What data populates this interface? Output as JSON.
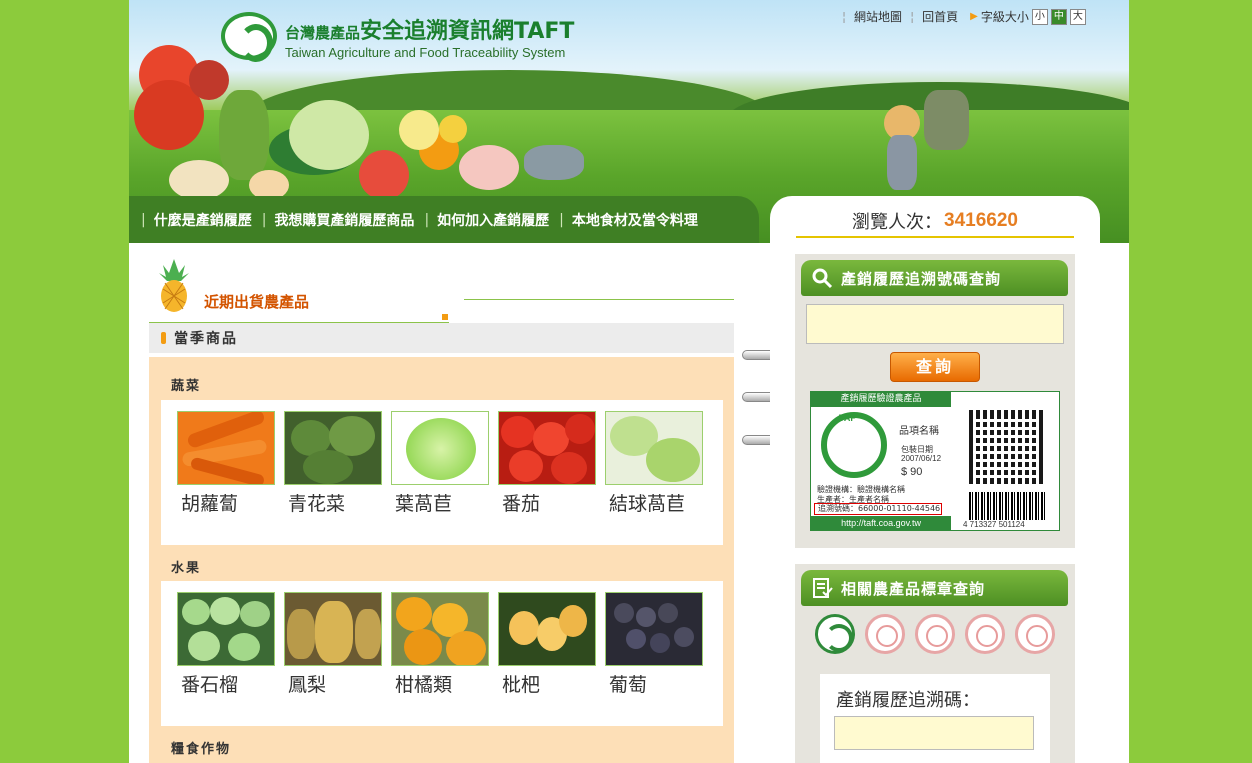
{
  "header": {
    "logo_small": "台灣農產品",
    "logo_title": "安全追溯資訊網TAFT",
    "logo_subtitle": "Taiwan Agriculture and Food Traceability System",
    "top_links": {
      "sitemap": "網站地圖",
      "home": "回首頁",
      "font_size_label": "字級大小",
      "font_small": "小",
      "font_medium": "中",
      "font_large": "大"
    }
  },
  "nav": {
    "items": [
      {
        "label": "什麼是產銷履歷"
      },
      {
        "label": "我想購買產銷履歷商品"
      },
      {
        "label": "如何加入產銷履歷"
      },
      {
        "label": "本地食材及當令料理"
      }
    ]
  },
  "main": {
    "section_title": "近期出貨農產品",
    "season_title": "當季商品",
    "categories": [
      {
        "label": "蔬菜",
        "items": [
          {
            "name": "胡蘿蔔"
          },
          {
            "name": "青花菜"
          },
          {
            "name": "葉萵苣"
          },
          {
            "name": "番茄"
          },
          {
            "name": "結球萵苣"
          }
        ]
      },
      {
        "label": "水果",
        "items": [
          {
            "name": "番石榴"
          },
          {
            "name": "鳳梨"
          },
          {
            "name": "柑橘類"
          },
          {
            "name": "枇杷"
          },
          {
            "name": "葡萄"
          }
        ]
      },
      {
        "label": "糧食作物",
        "items": []
      }
    ]
  },
  "sidebar": {
    "visits_label": "瀏覽人次：",
    "visits_count": "3416620",
    "trace_panel": {
      "title": "產銷履歷追溯號碼查詢",
      "input_value": "",
      "button_label": "查詢",
      "sample_label": {
        "header": "產銷履歷驗證農產品",
        "item_name": "品項名稱",
        "date_label": "包裝日期",
        "date": "2007/06/12",
        "price": "$ 90",
        "cert_body": "驗證機構：驗證機構名稱",
        "producer": "生產者：生產者名稱",
        "trace_code": "追溯號碼：66000-01110-44546",
        "url": "http://taft.coa.gov.tw",
        "barcode_number": "4 713327 501124"
      }
    },
    "label_panel": {
      "title": "相關農產品標章查詢",
      "badges": [
        {
          "icon": "tap-badge-icon"
        },
        {
          "icon": "cas-badge-icon"
        },
        {
          "icon": "organic-badge-icon"
        },
        {
          "icon": "cas-seal-icon"
        },
        {
          "icon": "ghp-badge-icon"
        }
      ],
      "code_label": "產銷履歷追溯碼：",
      "code_input_value": ""
    }
  },
  "colors": {
    "page_background": "#8ccb3c",
    "nav_background": "#3f7f24",
    "accent_orange": "#e67e22",
    "panel_green": "#5d9e2c",
    "product_area": "#fddfb7"
  }
}
